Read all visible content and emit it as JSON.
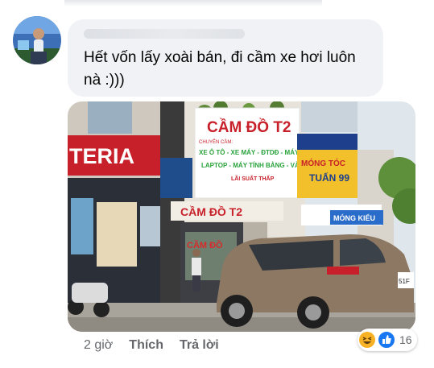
{
  "comment": {
    "text": "Hết vốn lấy xoài bán, đi cầm xe hơi luôn nà :)))"
  },
  "photo_signs": {
    "left_sign": "TERIA",
    "main_sign_title": "CẦM ĐỒ T2",
    "main_sign_subtitle": "CHUYÊN CẦM:",
    "main_sign_line1": "XE Ô TÔ - XE MÁY - ĐTDĐ - MÁY ẢNH",
    "main_sign_line2": "LAPTOP - MÁY TÍNH BẢNG - VÀNG...",
    "main_sign_line3": "LÃI SUẤT THẤP",
    "awning_sign": "CẦM ĐỒ T2",
    "window_text": "CẦM ĐỒ",
    "right_sign_top": "MÓNG TÓC",
    "right_sign_bottom": "TUẤN 99",
    "far_right_sign": "MÓNG KIỂU",
    "car_plate": "51F"
  },
  "actions": {
    "time": "2 giờ",
    "like": "Thích",
    "reply": "Trả lời"
  },
  "reactions": {
    "count": "16",
    "icons": [
      "haha-icon",
      "like-icon"
    ]
  },
  "colors": {
    "bubble": "#f0f2f5",
    "meta_text": "#65676b",
    "like_blue": "#1877f2",
    "haha_yellow": "#f7b125"
  }
}
